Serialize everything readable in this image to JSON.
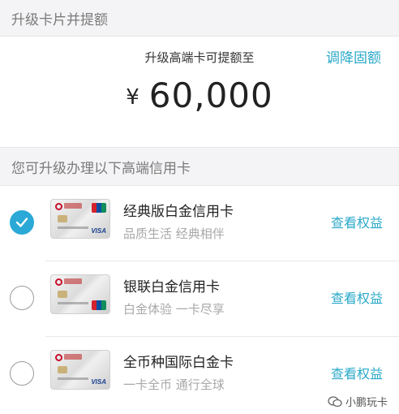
{
  "upgrade_section": {
    "header": "升级卡片并提额",
    "quota_title": "升级高端卡可提额至",
    "adjust_link": "调降固额",
    "currency_symbol": "¥",
    "amount": "60,000"
  },
  "card_section": {
    "header": "您可升级办理以下高端信用卡",
    "cards": [
      {
        "name": "经典版白金信用卡",
        "desc": "品质生活 经典相伴",
        "link": "查看权益",
        "selected": true
      },
      {
        "name": "银联白金信用卡",
        "desc": "白金体验 一卡尽享",
        "link": "查看权益",
        "selected": false
      },
      {
        "name": "全币种国际白金卡",
        "desc": "一卡全币 通行全球",
        "link": "查看权益",
        "selected": false
      }
    ]
  },
  "watermark": {
    "text": "小鹏玩卡",
    "icon": "wechat-icon"
  },
  "colors": {
    "accent": "#2aa9c9",
    "radio_checked": "#2aa9d6"
  }
}
